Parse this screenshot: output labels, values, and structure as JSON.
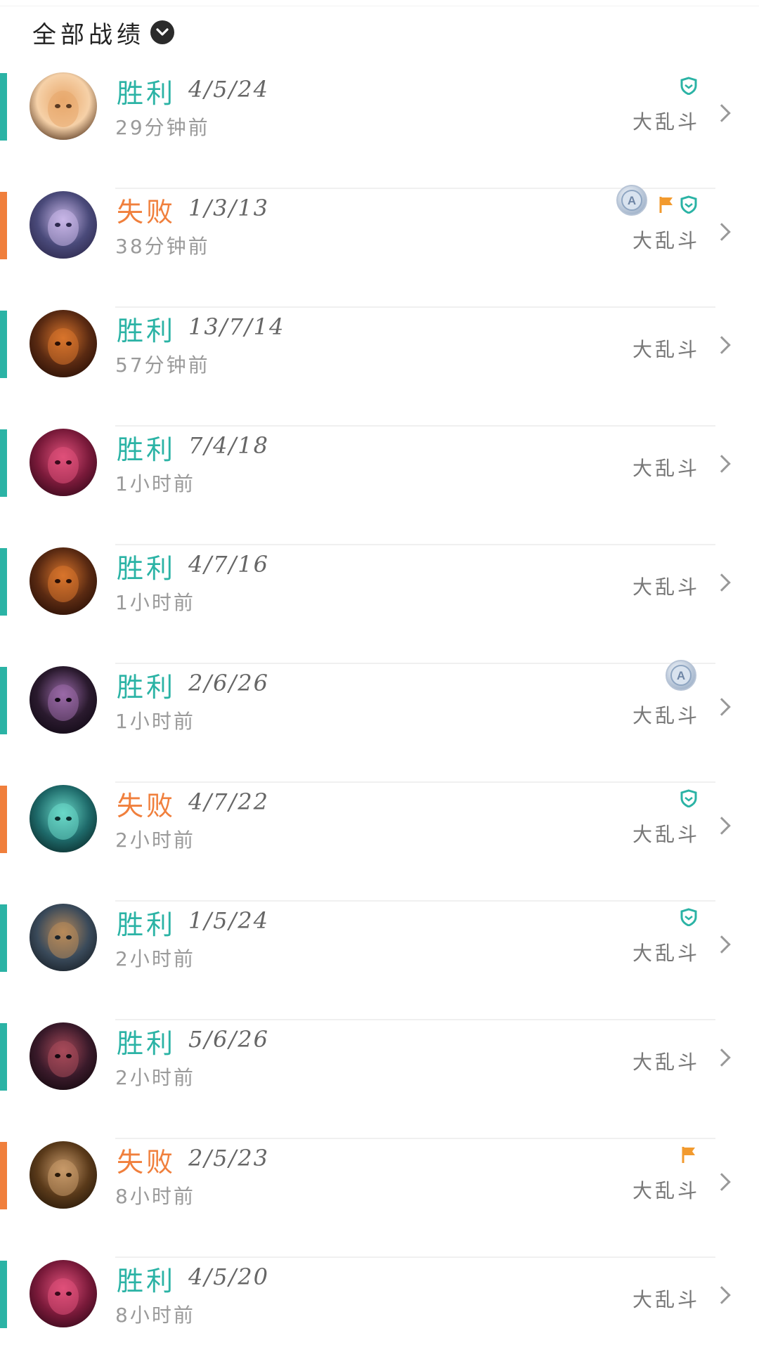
{
  "header": {
    "title": "全部战绩",
    "dropdown_icon": "chevron-down-icon"
  },
  "colors": {
    "win": "#2bb3a5",
    "loss": "#f07f3c"
  },
  "matches": [
    {
      "result": "胜利",
      "outcome": "win",
      "kda": "4/5/24",
      "time": "29分钟前",
      "mode": "大乱斗",
      "badges": [
        "shield"
      ]
    },
    {
      "result": "失败",
      "outcome": "loss",
      "kda": "1/3/13",
      "time": "38分钟前",
      "mode": "大乱斗",
      "badges": [
        "medal-a",
        "flag",
        "shield"
      ]
    },
    {
      "result": "胜利",
      "outcome": "win",
      "kda": "13/7/14",
      "time": "57分钟前",
      "mode": "大乱斗",
      "badges": []
    },
    {
      "result": "胜利",
      "outcome": "win",
      "kda": "7/4/18",
      "time": "1小时前",
      "mode": "大乱斗",
      "badges": []
    },
    {
      "result": "胜利",
      "outcome": "win",
      "kda": "4/7/16",
      "time": "1小时前",
      "mode": "大乱斗",
      "badges": []
    },
    {
      "result": "胜利",
      "outcome": "win",
      "kda": "2/6/26",
      "time": "1小时前",
      "mode": "大乱斗",
      "badges": [
        "medal-a"
      ]
    },
    {
      "result": "失败",
      "outcome": "loss",
      "kda": "4/7/22",
      "time": "2小时前",
      "mode": "大乱斗",
      "badges": [
        "shield"
      ]
    },
    {
      "result": "胜利",
      "outcome": "win",
      "kda": "1/5/24",
      "time": "2小时前",
      "mode": "大乱斗",
      "badges": [
        "shield"
      ]
    },
    {
      "result": "胜利",
      "outcome": "win",
      "kda": "5/6/26",
      "time": "2小时前",
      "mode": "大乱斗",
      "badges": []
    },
    {
      "result": "失败",
      "outcome": "loss",
      "kda": "2/5/23",
      "time": "8小时前",
      "mode": "大乱斗",
      "badges": [
        "flag"
      ]
    },
    {
      "result": "胜利",
      "outcome": "win",
      "kda": "4/5/20",
      "time": "8小时前",
      "mode": "大乱斗",
      "badges": []
    }
  ]
}
